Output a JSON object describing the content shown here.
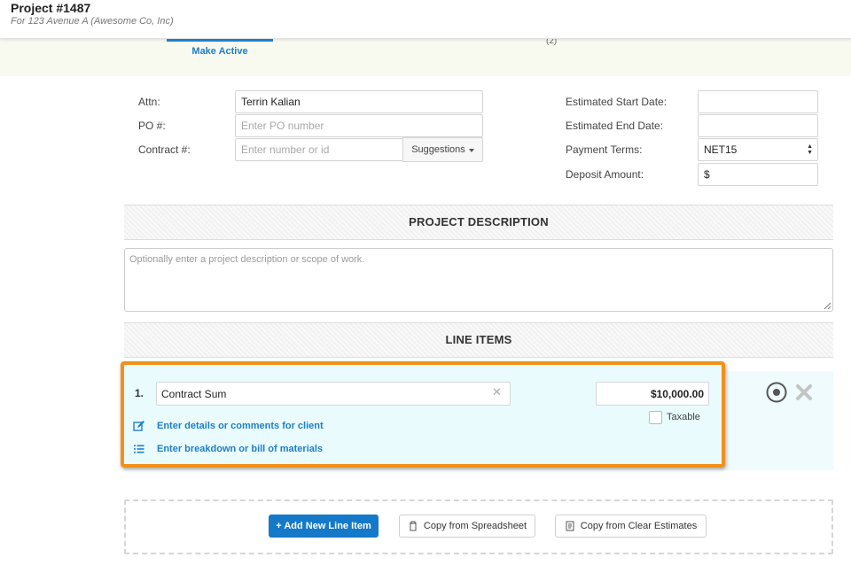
{
  "header": {
    "title": "Project #1487",
    "subtitle": "For 123 Avenue A (Awesome Co, Inc)"
  },
  "tabs": {
    "make_active": "Make Active",
    "stub": "(2)"
  },
  "form": {
    "attn_label": "Attn:",
    "attn_value": "Terrin Kalian",
    "po_label": "PO #:",
    "po_placeholder": "Enter PO number",
    "contract_label": "Contract #:",
    "contract_placeholder": "Enter number or id",
    "suggestions_label": "Suggestions",
    "start_date_label": "Estimated Start Date:",
    "end_date_label": "Estimated End Date:",
    "payment_terms_label": "Payment Terms:",
    "payment_terms_value": "NET15",
    "deposit_label": "Deposit Amount:",
    "deposit_value": "$"
  },
  "description": {
    "header": "PROJECT DESCRIPTION",
    "placeholder": "Optionally enter a project description or scope of work."
  },
  "line_items": {
    "header": "LINE ITEMS",
    "items": [
      {
        "number": "1.",
        "name": "Contract Sum",
        "amount": "$10,000.00",
        "taxable_label": "Taxable",
        "taxable": false,
        "details_link": "Enter details or comments for client",
        "breakdown_link": "Enter breakdown or bill of materials"
      }
    ]
  },
  "actions": {
    "add_line_item": "+ Add New Line Item",
    "copy_spreadsheet": "Copy from Spreadsheet",
    "copy_clear_estimates": "Copy from Clear Estimates"
  },
  "colors": {
    "accent": "#1479c9",
    "highlight": "#f39018",
    "row_bg": "#e9fbfd"
  }
}
